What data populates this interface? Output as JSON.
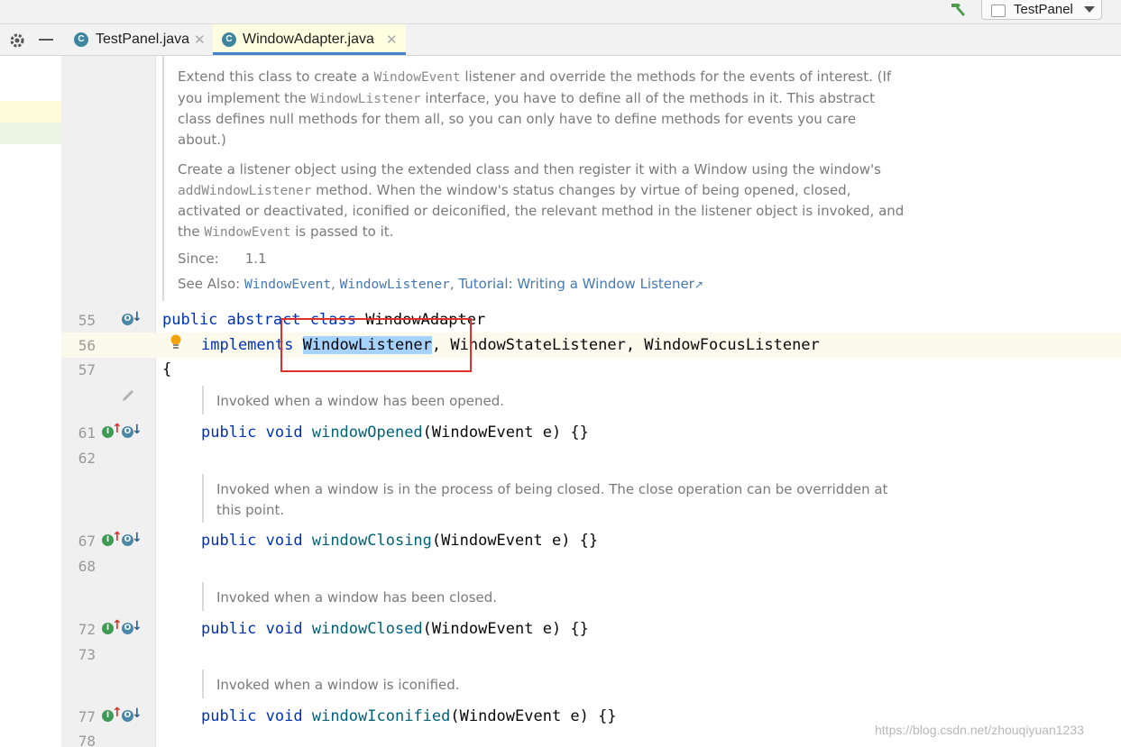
{
  "toolbar": {
    "run_config": "TestPanel",
    "icons": [
      "hammer-icon",
      "run-config-icon",
      "dropdown-arrow-icon"
    ]
  },
  "tabs": [
    {
      "label": "TestPanel.java",
      "icon": "java-class-icon",
      "active": false
    },
    {
      "label": "WindowAdapter.java",
      "icon": "java-class-icon",
      "active": true
    }
  ],
  "colors": {
    "keyword": "#0033b3",
    "method": "#00627a",
    "doc_text": "#7a7a7a",
    "link": "#4479b5",
    "selection": "#a6d2ff",
    "annotation_box": "#e0302b"
  },
  "javadoc": {
    "para1_pre": "Extend this class to create a ",
    "para1_code1": "WindowEvent",
    "para1_mid1": " listener and override the methods for the events of interest. (If",
    "para1_l2_pre": "you implement the ",
    "para1_code2": "WindowListener",
    "para1_l2_post": " interface, you have to define all of the methods in it. This abstract",
    "para1_l3": "class defines null methods for them all, so you can only have to define methods for events you care",
    "para1_l4": "about.)",
    "para2_l1": "Create a listener object using the extended class and then register it with a Window using the window's",
    "para2_code1": "addWindowListener",
    "para2_l2_post": " method. When the window's status changes by virtue of being opened, closed,",
    "para2_l3": "activated or deactivated, iconified or deiconified, the relevant method in the listener object is invoked, and",
    "para2_l4_pre": "the ",
    "para2_code2": "WindowEvent",
    "para2_l4_post": " is passed to it.",
    "since_label": "Since:",
    "since_value": "1.1",
    "see_also_label": "See Also:",
    "see_also_1": "WindowEvent",
    "see_also_2": "WindowListener",
    "see_also_3": "Tutorial: Writing a Window Listener",
    "sep": ","
  },
  "code": {
    "line55": {
      "number": "55",
      "kw": "public abstract class",
      "name": "WindowAdapter"
    },
    "line56": {
      "number": "56",
      "kw": "implements",
      "sel": "WindowListener",
      "rest": ", WindowStateListener, WindowFocusListener"
    },
    "line57": {
      "number": "57",
      "text": "{"
    },
    "methods": [
      {
        "doc": "Invoked when a window has been opened.",
        "number": "61",
        "next": "62",
        "kw": "public void",
        "name": "windowOpened",
        "args": "(WindowEvent e) {}"
      },
      {
        "doc_l1": "Invoked when a window is in the process of being closed. The close operation can be overridden at",
        "doc_l2": "this point.",
        "number": "67",
        "next": "68",
        "kw": "public void",
        "name": "windowClosing",
        "args": "(WindowEvent e) {}"
      },
      {
        "doc": "Invoked when a window has been closed.",
        "number": "72",
        "next": "73",
        "kw": "public void",
        "name": "windowClosed",
        "args": "(WindowEvent e) {}"
      },
      {
        "doc": "Invoked when a window is iconified.",
        "number": "77",
        "next": "78",
        "kw": "public void",
        "name": "windowIconified",
        "args": "(WindowEvent e) {}"
      }
    ]
  },
  "gutter_marks": {
    "implements": "I",
    "overrides": "O"
  },
  "watermark": "https://blog.csdn.net/zhouqiyuan1233"
}
